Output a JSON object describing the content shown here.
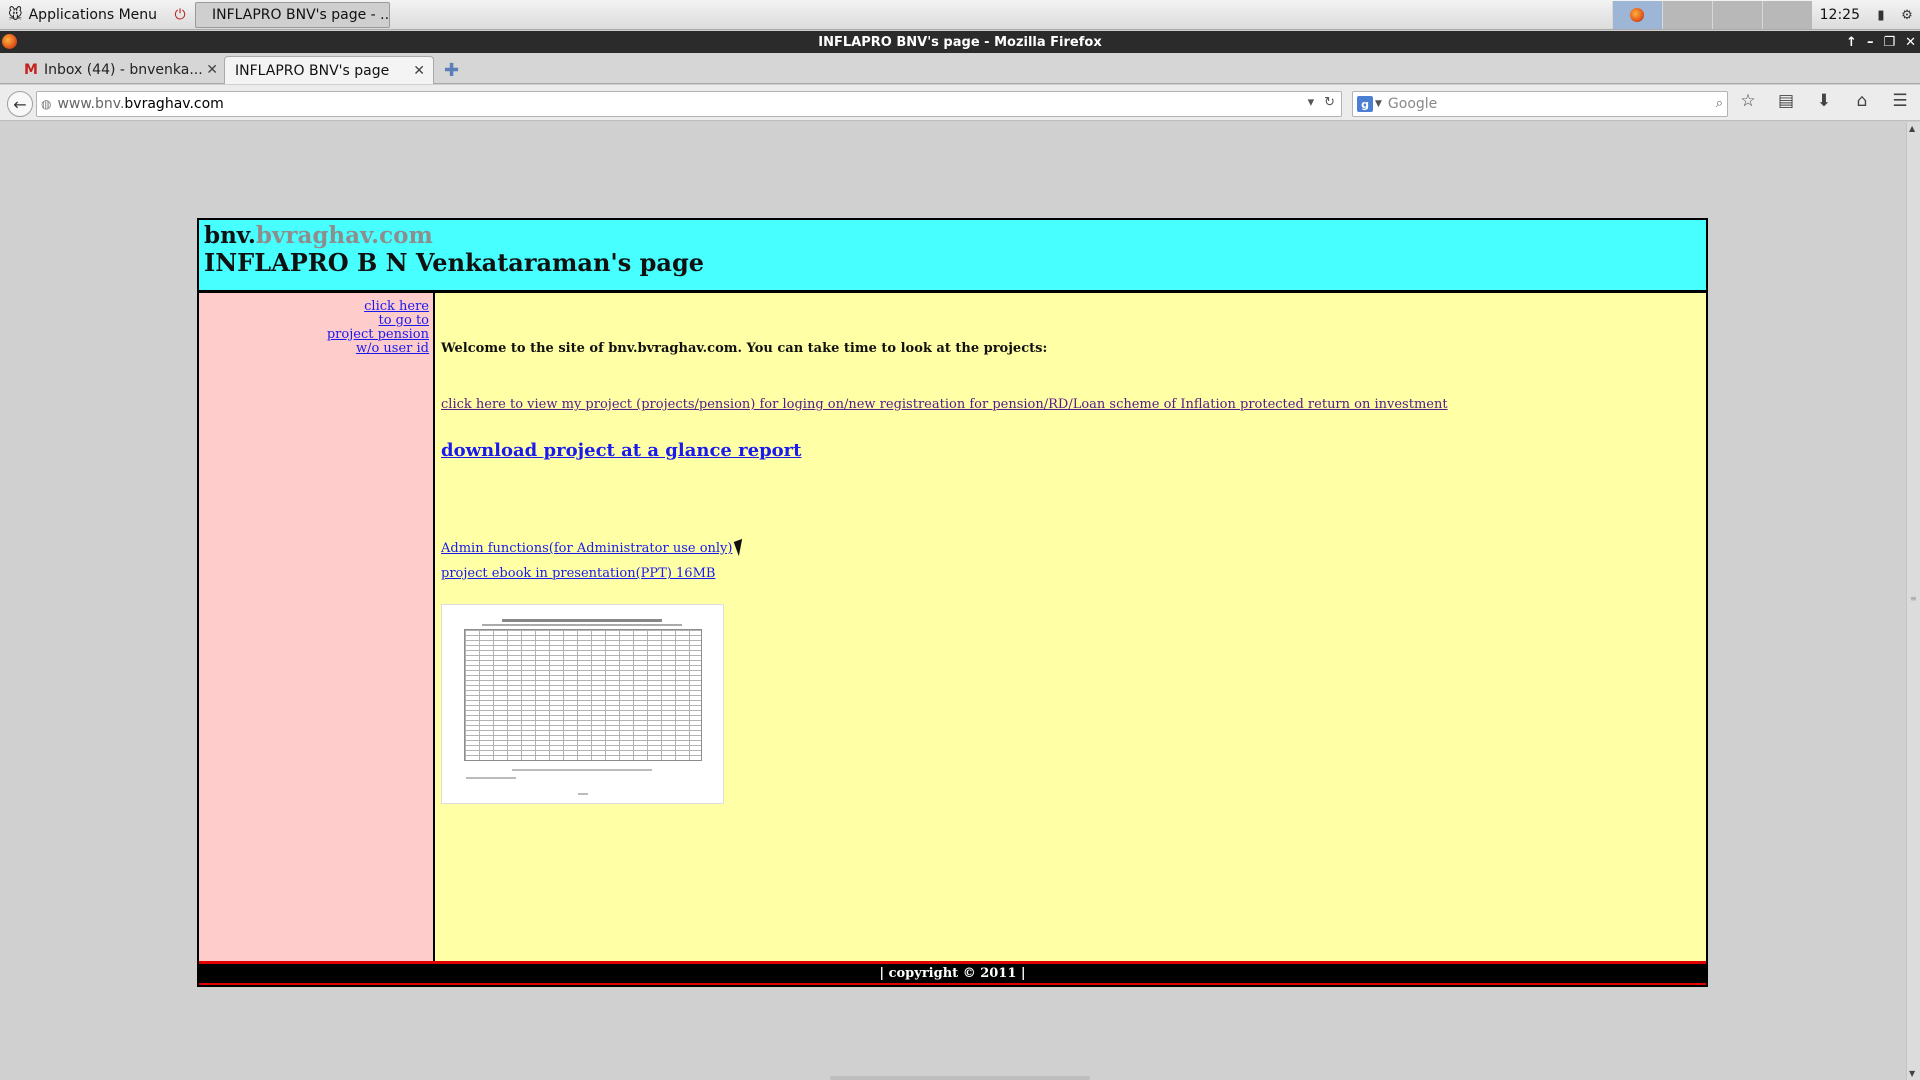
{
  "taskbar": {
    "apps_menu_label": "Applications Menu",
    "window_button_label": "INFLAPRO BNV's page - ...",
    "clock": "12:25"
  },
  "window": {
    "title": "INFLAPRO BNV's page - Mozilla Firefox"
  },
  "tabs": [
    {
      "label": "Inbox (44) - bnvenka...",
      "icon": "gmail-icon"
    },
    {
      "label": "INFLAPRO BNV's page",
      "icon": ""
    }
  ],
  "navbar": {
    "url_prefix": "www.bnv.",
    "url_host": "bvraghav.com",
    "search_placeholder": "Google"
  },
  "site": {
    "brand_bold": "bnv.",
    "brand_gray": "bvraghav.com",
    "heading": "INFLAPRO B N Venkataraman's page",
    "sidebar_links": [
      "click here",
      "to go to",
      "project pension",
      "w/o user id"
    ],
    "welcome": "Welcome to the site of bnv.bvraghav.com. You can take time to look at the projects:",
    "project_link": "click here to view my project (projects/pension) for loging on/new registreation for pension/RD/Loan scheme of Inflation protected return on investment",
    "download_link": "download project at a glance report",
    "admin_link": "Admin functions(for Administrator use only)",
    "ebook_link": "project ebook in presentation(PPT) 16MB",
    "footer": "| copyright © 2011 |"
  },
  "colors": {
    "header_bg": "#47ffff",
    "sidebar_bg": "#ffcccc",
    "main_bg": "#ffffa6",
    "footer_bg": "#000000",
    "footer_border": "#e00000",
    "link": "#1a1aee",
    "visited_link": "#551a8b"
  }
}
